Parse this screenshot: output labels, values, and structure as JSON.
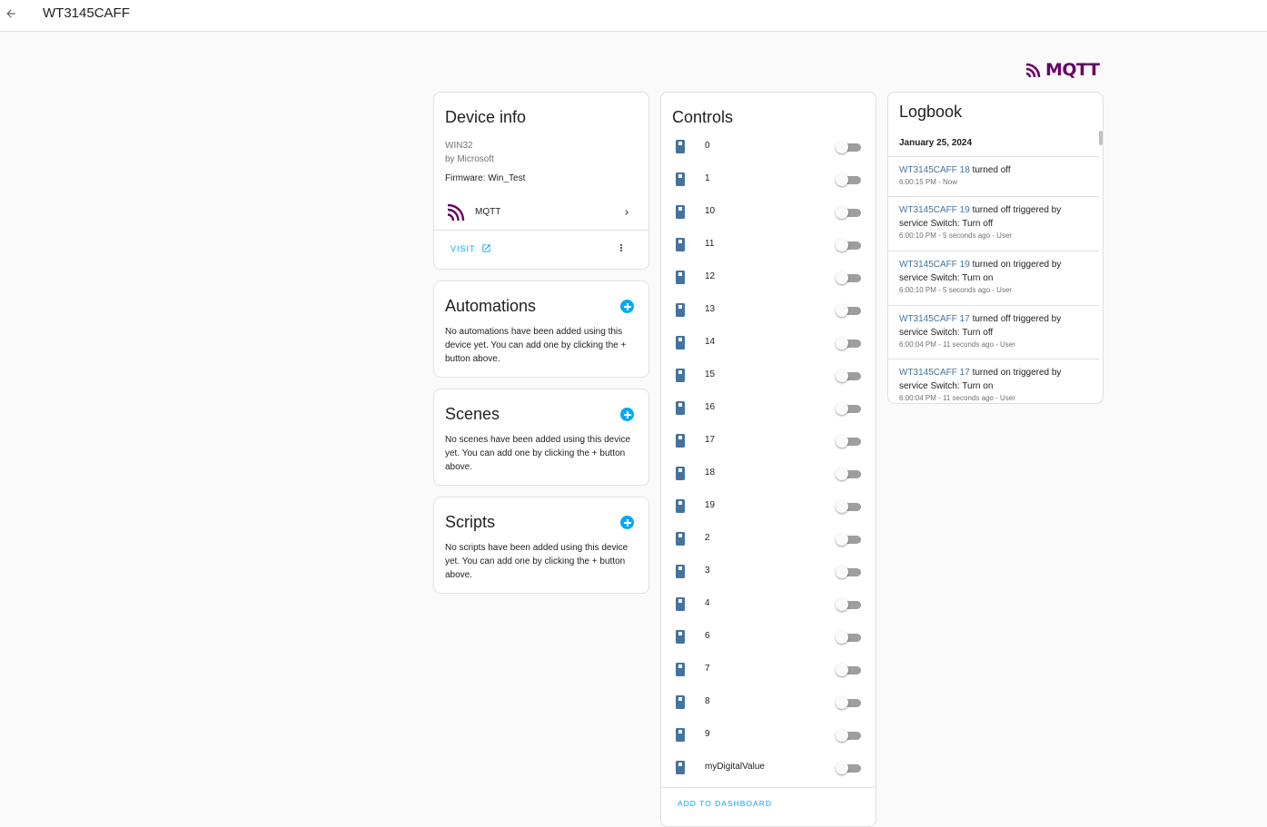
{
  "header": {
    "title": "WT3145CAFF"
  },
  "brand": {
    "logo_text": "MQTT",
    "color": "#660066"
  },
  "device_info": {
    "title": "Device info",
    "model": "WIN32",
    "manufacturer": "by Microsoft",
    "firmware": "Firmware: Win_Test",
    "integration": "MQTT",
    "visit_label": "VISIT"
  },
  "automations": {
    "title": "Automations",
    "description": "No automations have been added using this device yet. You can add one by clicking the + button above."
  },
  "scenes": {
    "title": "Scenes",
    "description": "No scenes have been added using this device yet. You can add one by clicking the + button above."
  },
  "scripts": {
    "title": "Scripts",
    "description": "No scripts have been added using this device yet. You can add one by clicking the + button above."
  },
  "controls": {
    "title": "Controls",
    "items": [
      {
        "name": "0",
        "state": "off"
      },
      {
        "name": "1",
        "state": "off"
      },
      {
        "name": "10",
        "state": "off"
      },
      {
        "name": "11",
        "state": "off"
      },
      {
        "name": "12",
        "state": "off"
      },
      {
        "name": "13",
        "state": "off"
      },
      {
        "name": "14",
        "state": "off"
      },
      {
        "name": "15",
        "state": "off"
      },
      {
        "name": "16",
        "state": "off"
      },
      {
        "name": "17",
        "state": "off"
      },
      {
        "name": "18",
        "state": "off"
      },
      {
        "name": "19",
        "state": "off"
      },
      {
        "name": "2",
        "state": "off"
      },
      {
        "name": "3",
        "state": "off"
      },
      {
        "name": "4",
        "state": "off"
      },
      {
        "name": "6",
        "state": "off"
      },
      {
        "name": "7",
        "state": "off"
      },
      {
        "name": "8",
        "state": "off"
      },
      {
        "name": "9",
        "state": "off"
      },
      {
        "name": "myDigitalValue",
        "state": "off"
      }
    ],
    "add_to_dashboard": "ADD TO DASHBOARD"
  },
  "logbook": {
    "title": "Logbook",
    "date": "January 25, 2024",
    "entries": [
      {
        "entity": "WT3145CAFF 18",
        "message": " turned off",
        "time": "6:00:15 PM - Now"
      },
      {
        "entity": "WT3145CAFF 19",
        "message": " turned off triggered by service Switch: Turn off",
        "time": "6:00:10 PM - 5 seconds ago - User"
      },
      {
        "entity": "WT3145CAFF 19",
        "message": " turned on triggered by service Switch: Turn on",
        "time": "6:00:10 PM - 5 seconds ago - User"
      },
      {
        "entity": "WT3145CAFF 17",
        "message": " turned off triggered by service Switch: Turn off",
        "time": "6:00:04 PM - 11 seconds ago - User"
      },
      {
        "entity": "WT3145CAFF 17",
        "message": " turned on triggered by service Switch: Turn on",
        "time": "6:00:04 PM - 11 seconds ago - User"
      }
    ]
  },
  "colors": {
    "accent": "#03a9f4",
    "entity_icon": "#44739e",
    "brand": "#660066"
  },
  "icons": {
    "back": "arrow-left-icon",
    "integration": "mqtt-icon",
    "chevron": "chevron-right-icon",
    "external": "open-in-new-icon",
    "menu": "dots-vertical-icon",
    "add": "plus-circle-icon",
    "entity": "switch-icon"
  }
}
